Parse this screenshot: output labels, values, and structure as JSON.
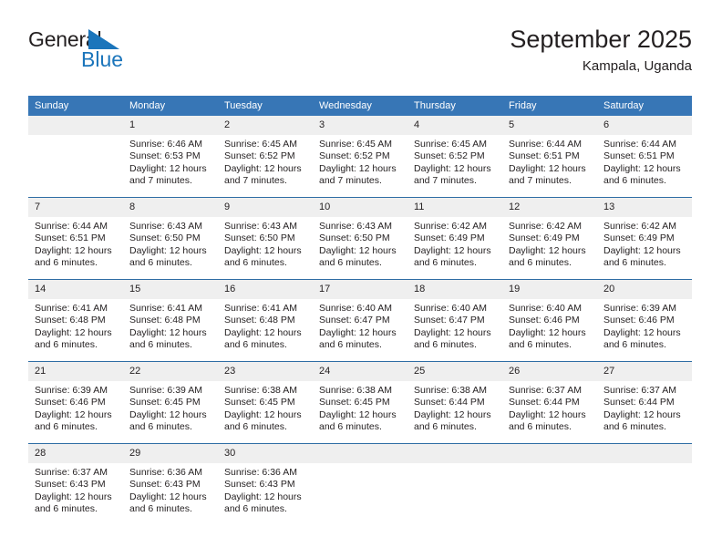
{
  "brand": {
    "name_part1": "General",
    "name_part2": "Blue",
    "accent_color": "#1b75bb"
  },
  "header": {
    "title": "September 2025",
    "subtitle": "Kampala, Uganda"
  },
  "theme": {
    "header_bg": "#3776b6",
    "row_divider": "#2e6da4",
    "daynum_bg": "#efefef",
    "text": "#231f20"
  },
  "weekday_headers": [
    "Sunday",
    "Monday",
    "Tuesday",
    "Wednesday",
    "Thursday",
    "Friday",
    "Saturday"
  ],
  "weeks": [
    [
      {
        "day": "",
        "sunrise": "",
        "sunset": "",
        "daylight_line1": "",
        "daylight_line2": "",
        "blank": true
      },
      {
        "day": "1",
        "sunrise": "Sunrise: 6:46 AM",
        "sunset": "Sunset: 6:53 PM",
        "daylight_line1": "Daylight: 12 hours",
        "daylight_line2": "and 7 minutes."
      },
      {
        "day": "2",
        "sunrise": "Sunrise: 6:45 AM",
        "sunset": "Sunset: 6:52 PM",
        "daylight_line1": "Daylight: 12 hours",
        "daylight_line2": "and 7 minutes."
      },
      {
        "day": "3",
        "sunrise": "Sunrise: 6:45 AM",
        "sunset": "Sunset: 6:52 PM",
        "daylight_line1": "Daylight: 12 hours",
        "daylight_line2": "and 7 minutes."
      },
      {
        "day": "4",
        "sunrise": "Sunrise: 6:45 AM",
        "sunset": "Sunset: 6:52 PM",
        "daylight_line1": "Daylight: 12 hours",
        "daylight_line2": "and 7 minutes."
      },
      {
        "day": "5",
        "sunrise": "Sunrise: 6:44 AM",
        "sunset": "Sunset: 6:51 PM",
        "daylight_line1": "Daylight: 12 hours",
        "daylight_line2": "and 7 minutes."
      },
      {
        "day": "6",
        "sunrise": "Sunrise: 6:44 AM",
        "sunset": "Sunset: 6:51 PM",
        "daylight_line1": "Daylight: 12 hours",
        "daylight_line2": "and 6 minutes."
      }
    ],
    [
      {
        "day": "7",
        "sunrise": "Sunrise: 6:44 AM",
        "sunset": "Sunset: 6:51 PM",
        "daylight_line1": "Daylight: 12 hours",
        "daylight_line2": "and 6 minutes."
      },
      {
        "day": "8",
        "sunrise": "Sunrise: 6:43 AM",
        "sunset": "Sunset: 6:50 PM",
        "daylight_line1": "Daylight: 12 hours",
        "daylight_line2": "and 6 minutes."
      },
      {
        "day": "9",
        "sunrise": "Sunrise: 6:43 AM",
        "sunset": "Sunset: 6:50 PM",
        "daylight_line1": "Daylight: 12 hours",
        "daylight_line2": "and 6 minutes."
      },
      {
        "day": "10",
        "sunrise": "Sunrise: 6:43 AM",
        "sunset": "Sunset: 6:50 PM",
        "daylight_line1": "Daylight: 12 hours",
        "daylight_line2": "and 6 minutes."
      },
      {
        "day": "11",
        "sunrise": "Sunrise: 6:42 AM",
        "sunset": "Sunset: 6:49 PM",
        "daylight_line1": "Daylight: 12 hours",
        "daylight_line2": "and 6 minutes."
      },
      {
        "day": "12",
        "sunrise": "Sunrise: 6:42 AM",
        "sunset": "Sunset: 6:49 PM",
        "daylight_line1": "Daylight: 12 hours",
        "daylight_line2": "and 6 minutes."
      },
      {
        "day": "13",
        "sunrise": "Sunrise: 6:42 AM",
        "sunset": "Sunset: 6:49 PM",
        "daylight_line1": "Daylight: 12 hours",
        "daylight_line2": "and 6 minutes."
      }
    ],
    [
      {
        "day": "14",
        "sunrise": "Sunrise: 6:41 AM",
        "sunset": "Sunset: 6:48 PM",
        "daylight_line1": "Daylight: 12 hours",
        "daylight_line2": "and 6 minutes."
      },
      {
        "day": "15",
        "sunrise": "Sunrise: 6:41 AM",
        "sunset": "Sunset: 6:48 PM",
        "daylight_line1": "Daylight: 12 hours",
        "daylight_line2": "and 6 minutes."
      },
      {
        "day": "16",
        "sunrise": "Sunrise: 6:41 AM",
        "sunset": "Sunset: 6:48 PM",
        "daylight_line1": "Daylight: 12 hours",
        "daylight_line2": "and 6 minutes."
      },
      {
        "day": "17",
        "sunrise": "Sunrise: 6:40 AM",
        "sunset": "Sunset: 6:47 PM",
        "daylight_line1": "Daylight: 12 hours",
        "daylight_line2": "and 6 minutes."
      },
      {
        "day": "18",
        "sunrise": "Sunrise: 6:40 AM",
        "sunset": "Sunset: 6:47 PM",
        "daylight_line1": "Daylight: 12 hours",
        "daylight_line2": "and 6 minutes."
      },
      {
        "day": "19",
        "sunrise": "Sunrise: 6:40 AM",
        "sunset": "Sunset: 6:46 PM",
        "daylight_line1": "Daylight: 12 hours",
        "daylight_line2": "and 6 minutes."
      },
      {
        "day": "20",
        "sunrise": "Sunrise: 6:39 AM",
        "sunset": "Sunset: 6:46 PM",
        "daylight_line1": "Daylight: 12 hours",
        "daylight_line2": "and 6 minutes."
      }
    ],
    [
      {
        "day": "21",
        "sunrise": "Sunrise: 6:39 AM",
        "sunset": "Sunset: 6:46 PM",
        "daylight_line1": "Daylight: 12 hours",
        "daylight_line2": "and 6 minutes."
      },
      {
        "day": "22",
        "sunrise": "Sunrise: 6:39 AM",
        "sunset": "Sunset: 6:45 PM",
        "daylight_line1": "Daylight: 12 hours",
        "daylight_line2": "and 6 minutes."
      },
      {
        "day": "23",
        "sunrise": "Sunrise: 6:38 AM",
        "sunset": "Sunset: 6:45 PM",
        "daylight_line1": "Daylight: 12 hours",
        "daylight_line2": "and 6 minutes."
      },
      {
        "day": "24",
        "sunrise": "Sunrise: 6:38 AM",
        "sunset": "Sunset: 6:45 PM",
        "daylight_line1": "Daylight: 12 hours",
        "daylight_line2": "and 6 minutes."
      },
      {
        "day": "25",
        "sunrise": "Sunrise: 6:38 AM",
        "sunset": "Sunset: 6:44 PM",
        "daylight_line1": "Daylight: 12 hours",
        "daylight_line2": "and 6 minutes."
      },
      {
        "day": "26",
        "sunrise": "Sunrise: 6:37 AM",
        "sunset": "Sunset: 6:44 PM",
        "daylight_line1": "Daylight: 12 hours",
        "daylight_line2": "and 6 minutes."
      },
      {
        "day": "27",
        "sunrise": "Sunrise: 6:37 AM",
        "sunset": "Sunset: 6:44 PM",
        "daylight_line1": "Daylight: 12 hours",
        "daylight_line2": "and 6 minutes."
      }
    ],
    [
      {
        "day": "28",
        "sunrise": "Sunrise: 6:37 AM",
        "sunset": "Sunset: 6:43 PM",
        "daylight_line1": "Daylight: 12 hours",
        "daylight_line2": "and 6 minutes."
      },
      {
        "day": "29",
        "sunrise": "Sunrise: 6:36 AM",
        "sunset": "Sunset: 6:43 PM",
        "daylight_line1": "Daylight: 12 hours",
        "daylight_line2": "and 6 minutes."
      },
      {
        "day": "30",
        "sunrise": "Sunrise: 6:36 AM",
        "sunset": "Sunset: 6:43 PM",
        "daylight_line1": "Daylight: 12 hours",
        "daylight_line2": "and 6 minutes."
      },
      {
        "day": "",
        "sunrise": "",
        "sunset": "",
        "daylight_line1": "",
        "daylight_line2": "",
        "blank": true
      },
      {
        "day": "",
        "sunrise": "",
        "sunset": "",
        "daylight_line1": "",
        "daylight_line2": "",
        "blank": true
      },
      {
        "day": "",
        "sunrise": "",
        "sunset": "",
        "daylight_line1": "",
        "daylight_line2": "",
        "blank": true
      },
      {
        "day": "",
        "sunrise": "",
        "sunset": "",
        "daylight_line1": "",
        "daylight_line2": "",
        "blank": true
      }
    ]
  ]
}
